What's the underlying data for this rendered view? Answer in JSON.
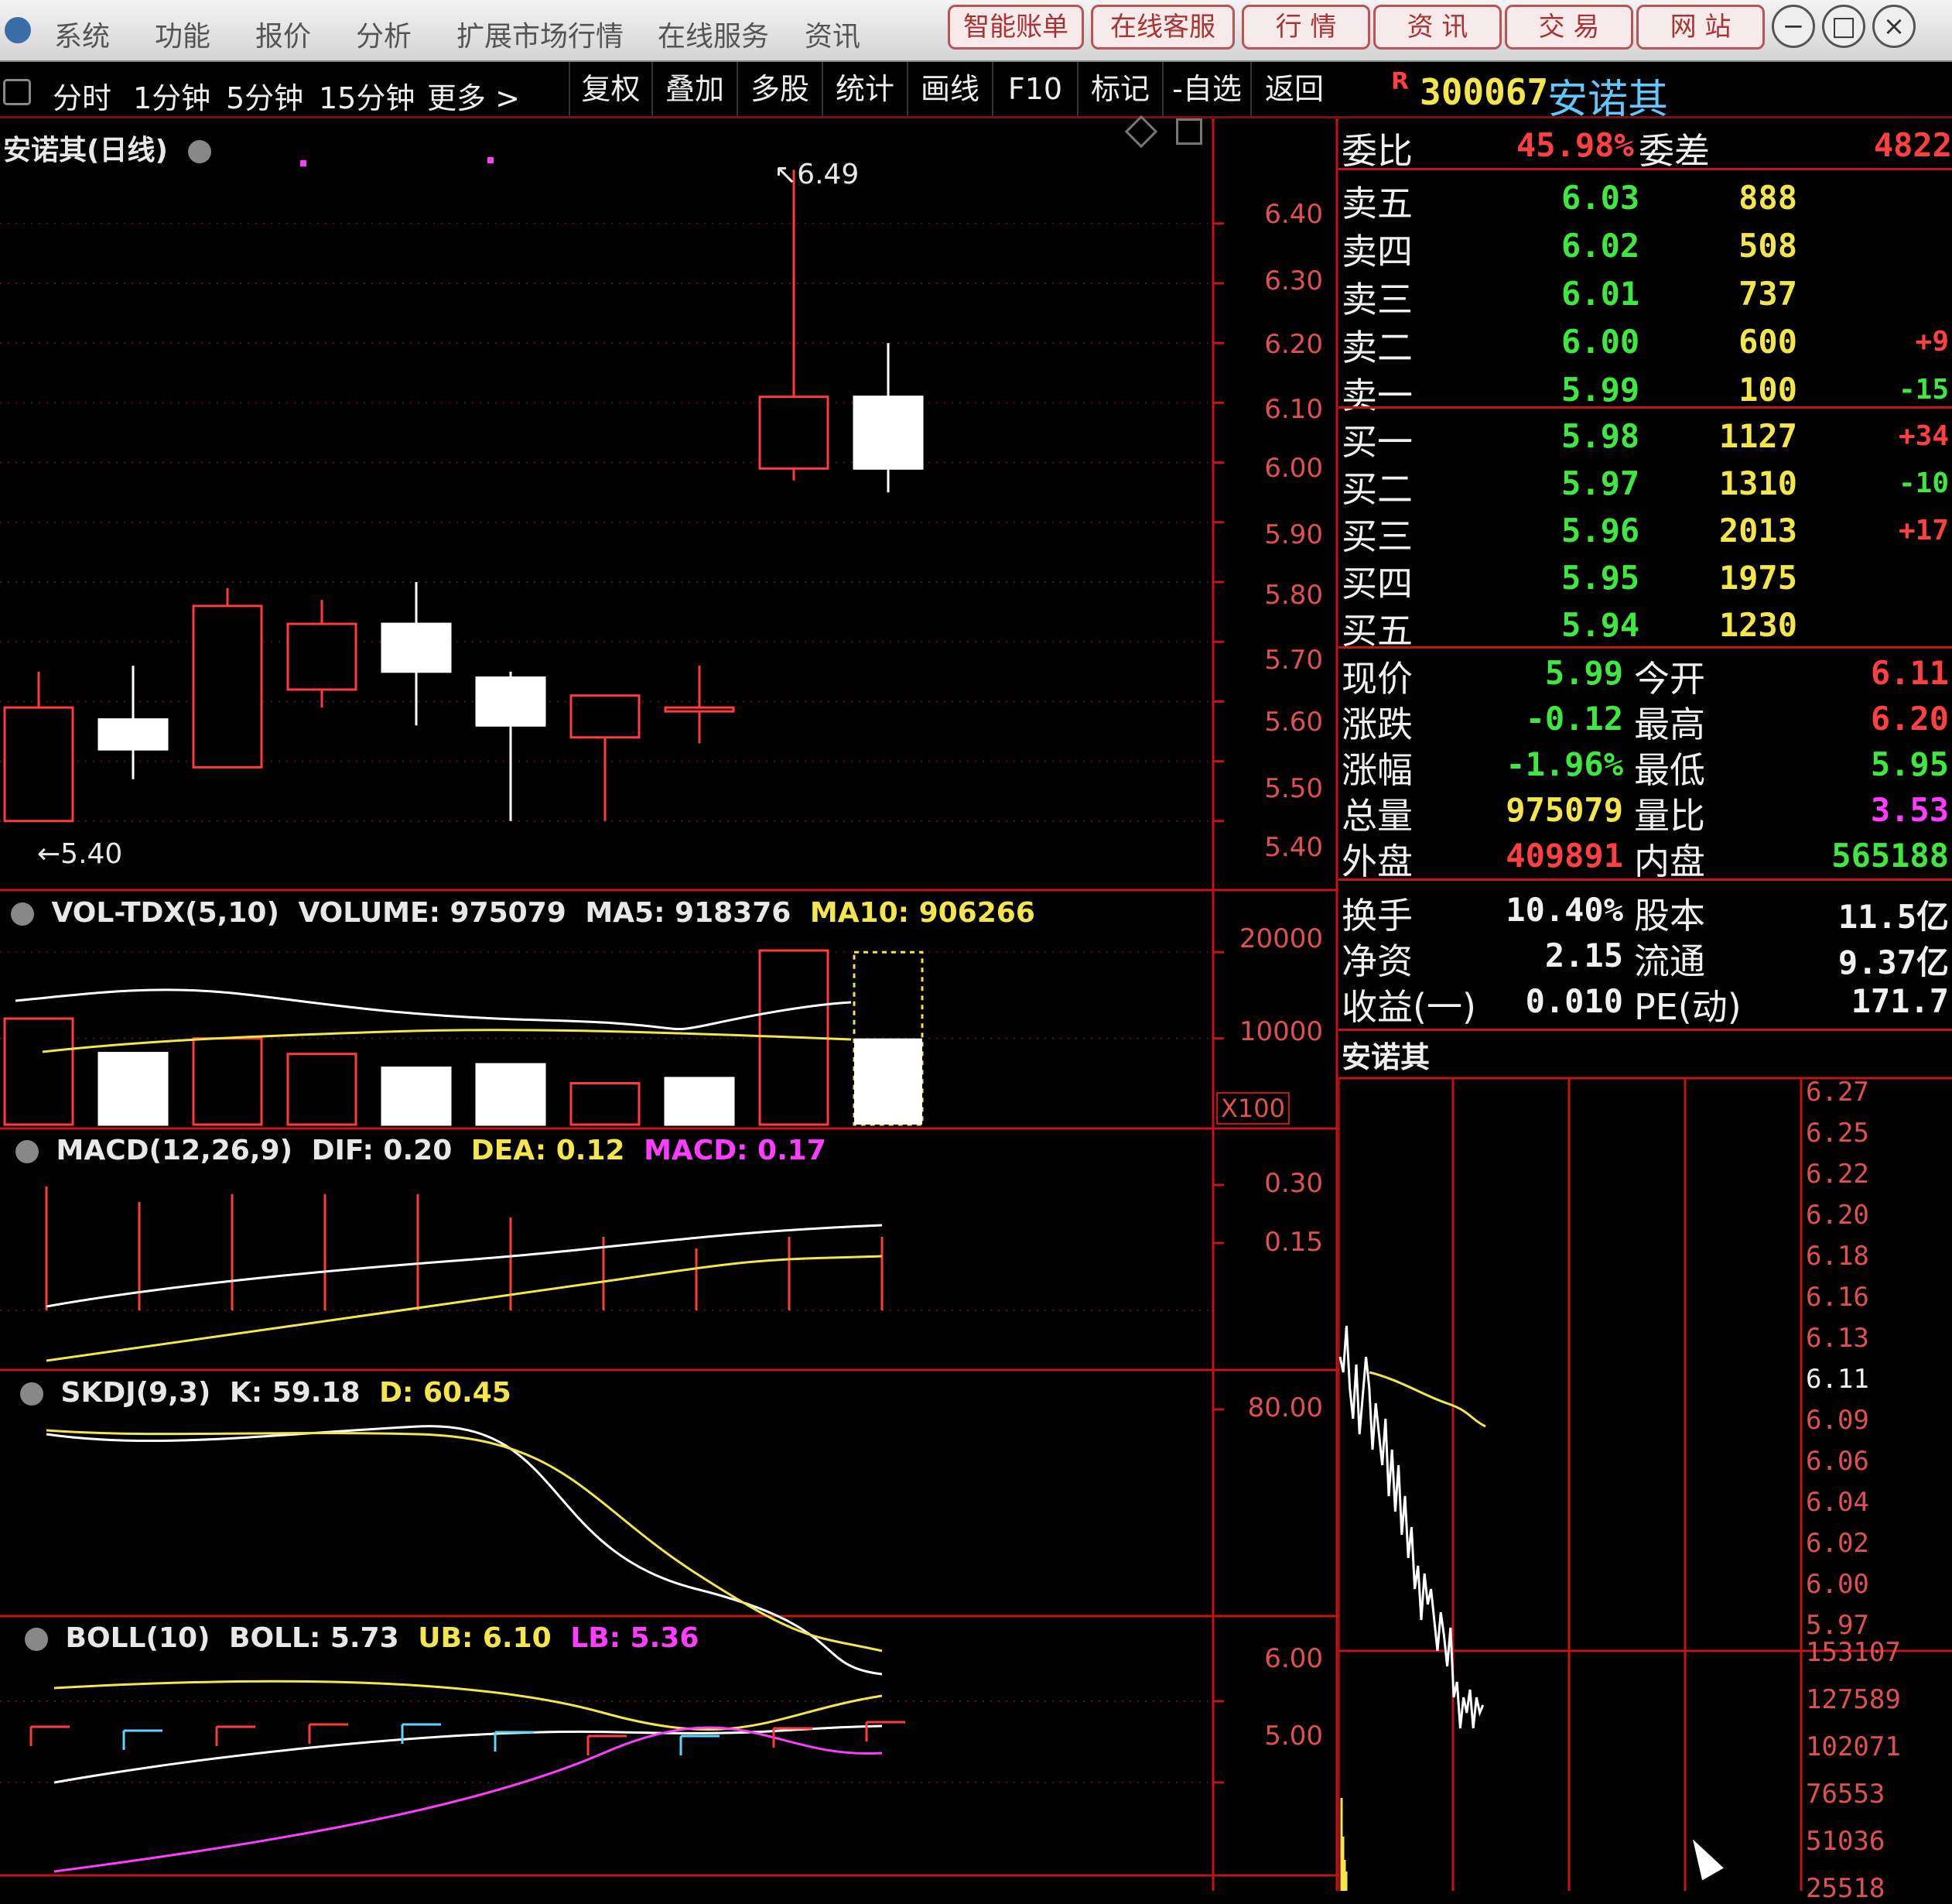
{
  "menu": {
    "items": [
      "系统",
      "功能",
      "报价",
      "分析",
      "扩展市场行情",
      "在线服务",
      "资讯"
    ],
    "buttons": [
      "智能账单",
      "在线客服",
      "行 情",
      "资 讯",
      "交 易",
      "网 站"
    ],
    "window_controls": [
      "−",
      "□",
      "×"
    ]
  },
  "toolbar": {
    "periods": [
      "分时",
      "1分钟",
      "5分钟",
      "15分钟",
      "更多 >"
    ],
    "tools": [
      "复权",
      "叠加",
      "多股",
      "统计",
      "画线",
      "F10",
      "标记",
      "-自选",
      "返回"
    ]
  },
  "stock": {
    "flag": "R",
    "code": "300067",
    "name": "安诺其"
  },
  "kline": {
    "title": "安诺其(日线)",
    "high_label": "6.49",
    "low_label": "5.40",
    "axis": [
      "6.40",
      "6.30",
      "6.20",
      "6.10",
      "6.00",
      "5.90",
      "5.80",
      "5.70",
      "5.60",
      "5.50",
      "5.40"
    ],
    "candles": [
      {
        "o": 5.4,
        "c": 5.59,
        "h": 5.65,
        "l": 5.4
      },
      {
        "o": 5.57,
        "c": 5.52,
        "h": 5.66,
        "l": 5.47
      },
      {
        "o": 5.49,
        "c": 5.76,
        "h": 5.79,
        "l": 5.49
      },
      {
        "o": 5.62,
        "c": 5.73,
        "h": 5.77,
        "l": 5.59
      },
      {
        "o": 5.73,
        "c": 5.65,
        "h": 5.8,
        "l": 5.56
      },
      {
        "o": 5.64,
        "c": 5.56,
        "h": 5.65,
        "l": 5.4
      },
      {
        "o": 5.54,
        "c": 5.61,
        "h": 5.61,
        "l": 5.4
      },
      {
        "o": 5.59,
        "c": 5.59,
        "h": 5.66,
        "l": 5.53
      },
      {
        "o": 5.99,
        "c": 6.11,
        "h": 6.49,
        "l": 5.97
      },
      {
        "o": 6.11,
        "c": 5.99,
        "h": 6.2,
        "l": 5.95
      }
    ]
  },
  "volume": {
    "indicator": "VOL-TDX(5,10)",
    "volume_text": "VOLUME: 975079",
    "ma5_text": "MA5: 918376",
    "ma10_text": "MA10: 906266",
    "axis": [
      "20000",
      "10000"
    ],
    "unit": "X100",
    "bars": [
      {
        "v": 12300,
        "up": true
      },
      {
        "v": 8300,
        "up": false
      },
      {
        "v": 10000,
        "up": true
      },
      {
        "v": 8200,
        "up": true
      },
      {
        "v": 6600,
        "up": false
      },
      {
        "v": 7000,
        "up": false
      },
      {
        "v": 4800,
        "up": true
      },
      {
        "v": 5400,
        "up": false
      },
      {
        "v": 20200,
        "up": true
      },
      {
        "v": 20000,
        "solid": 10000,
        "up": false
      }
    ]
  },
  "macd": {
    "indicator": "MACD(12,26,9)",
    "dif_text": "DIF: 0.20",
    "dea_text": "DEA: 0.12",
    "macd_text": "MACD: 0.17",
    "axis": [
      "0.30",
      "0.15"
    ]
  },
  "skdj": {
    "indicator": "SKDJ(9,3)",
    "k_text": "K: 59.18",
    "d_text": "D: 60.45",
    "axis": [
      "80.00"
    ]
  },
  "boll": {
    "indicator": "BOLL(10)",
    "boll_text": "BOLL: 5.73",
    "ub_text": "UB: 6.10",
    "lb_text": "LB: 5.36",
    "axis": [
      "6.00",
      "5.00"
    ]
  },
  "quote": {
    "weibi": {
      "label": "委比",
      "value": "45.98%",
      "label2": "委差",
      "value2": "4822"
    },
    "asks": [
      {
        "label": "卖五",
        "price": "6.03",
        "vol": "888",
        "chg": ""
      },
      {
        "label": "卖四",
        "price": "6.02",
        "vol": "508",
        "chg": ""
      },
      {
        "label": "卖三",
        "price": "6.01",
        "vol": "737",
        "chg": ""
      },
      {
        "label": "卖二",
        "price": "6.00",
        "vol": "600",
        "chg": "+9"
      },
      {
        "label": "卖一",
        "price": "5.99",
        "vol": "100",
        "chg": "-15"
      }
    ],
    "bids": [
      {
        "label": "买一",
        "price": "5.98",
        "vol": "1127",
        "chg": "+34"
      },
      {
        "label": "买二",
        "price": "5.97",
        "vol": "1310",
        "chg": "-10"
      },
      {
        "label": "买三",
        "price": "5.96",
        "vol": "2013",
        "chg": "+17"
      },
      {
        "label": "买四",
        "price": "5.95",
        "vol": "1975",
        "chg": ""
      },
      {
        "label": "买五",
        "price": "5.94",
        "vol": "1230",
        "chg": ""
      }
    ],
    "stats": [
      {
        "l1": "现价",
        "v1": "5.99",
        "l2": "今开",
        "v2": "6.11"
      },
      {
        "l1": "涨跌",
        "v1": "-0.12",
        "l2": "最高",
        "v2": "6.20"
      },
      {
        "l1": "涨幅",
        "v1": "-1.96%",
        "l2": "最低",
        "v2": "5.95"
      },
      {
        "l1": "总量",
        "v1": "975079",
        "l2": "量比",
        "v2": "3.53"
      },
      {
        "l1": "外盘",
        "v1": "409891",
        "l2": "内盘",
        "v2": "565188"
      }
    ],
    "fundamentals": [
      {
        "l1": "换手",
        "v1": "10.40%",
        "l2": "股本",
        "v2": "11.5亿"
      },
      {
        "l1": "净资",
        "v1": "2.15",
        "l2": "流通",
        "v2": "9.37亿"
      },
      {
        "l1": "收益(一)",
        "v1": "0.010",
        "l2": "PE(动)",
        "v2": "171.7"
      }
    ]
  },
  "mini_chart": {
    "title": "安诺其",
    "price_axis": [
      "6.27",
      "6.25",
      "6.22",
      "6.20",
      "6.18",
      "6.16",
      "6.13",
      "6.11",
      "6.09",
      "6.06",
      "6.04",
      "6.02",
      "6.00",
      "5.97"
    ],
    "volume_axis": [
      "153107",
      "127589",
      "102071",
      "76553",
      "51036",
      "25518"
    ]
  },
  "colors": {
    "up": "#ff3b3b",
    "down": "#ffffff",
    "frame": "#c41414",
    "grid": "#5a1010",
    "green": "#3fe83f",
    "yellow": "#f4e64a",
    "magenta": "#ff3cff",
    "cyan": "#5fd4ff"
  }
}
